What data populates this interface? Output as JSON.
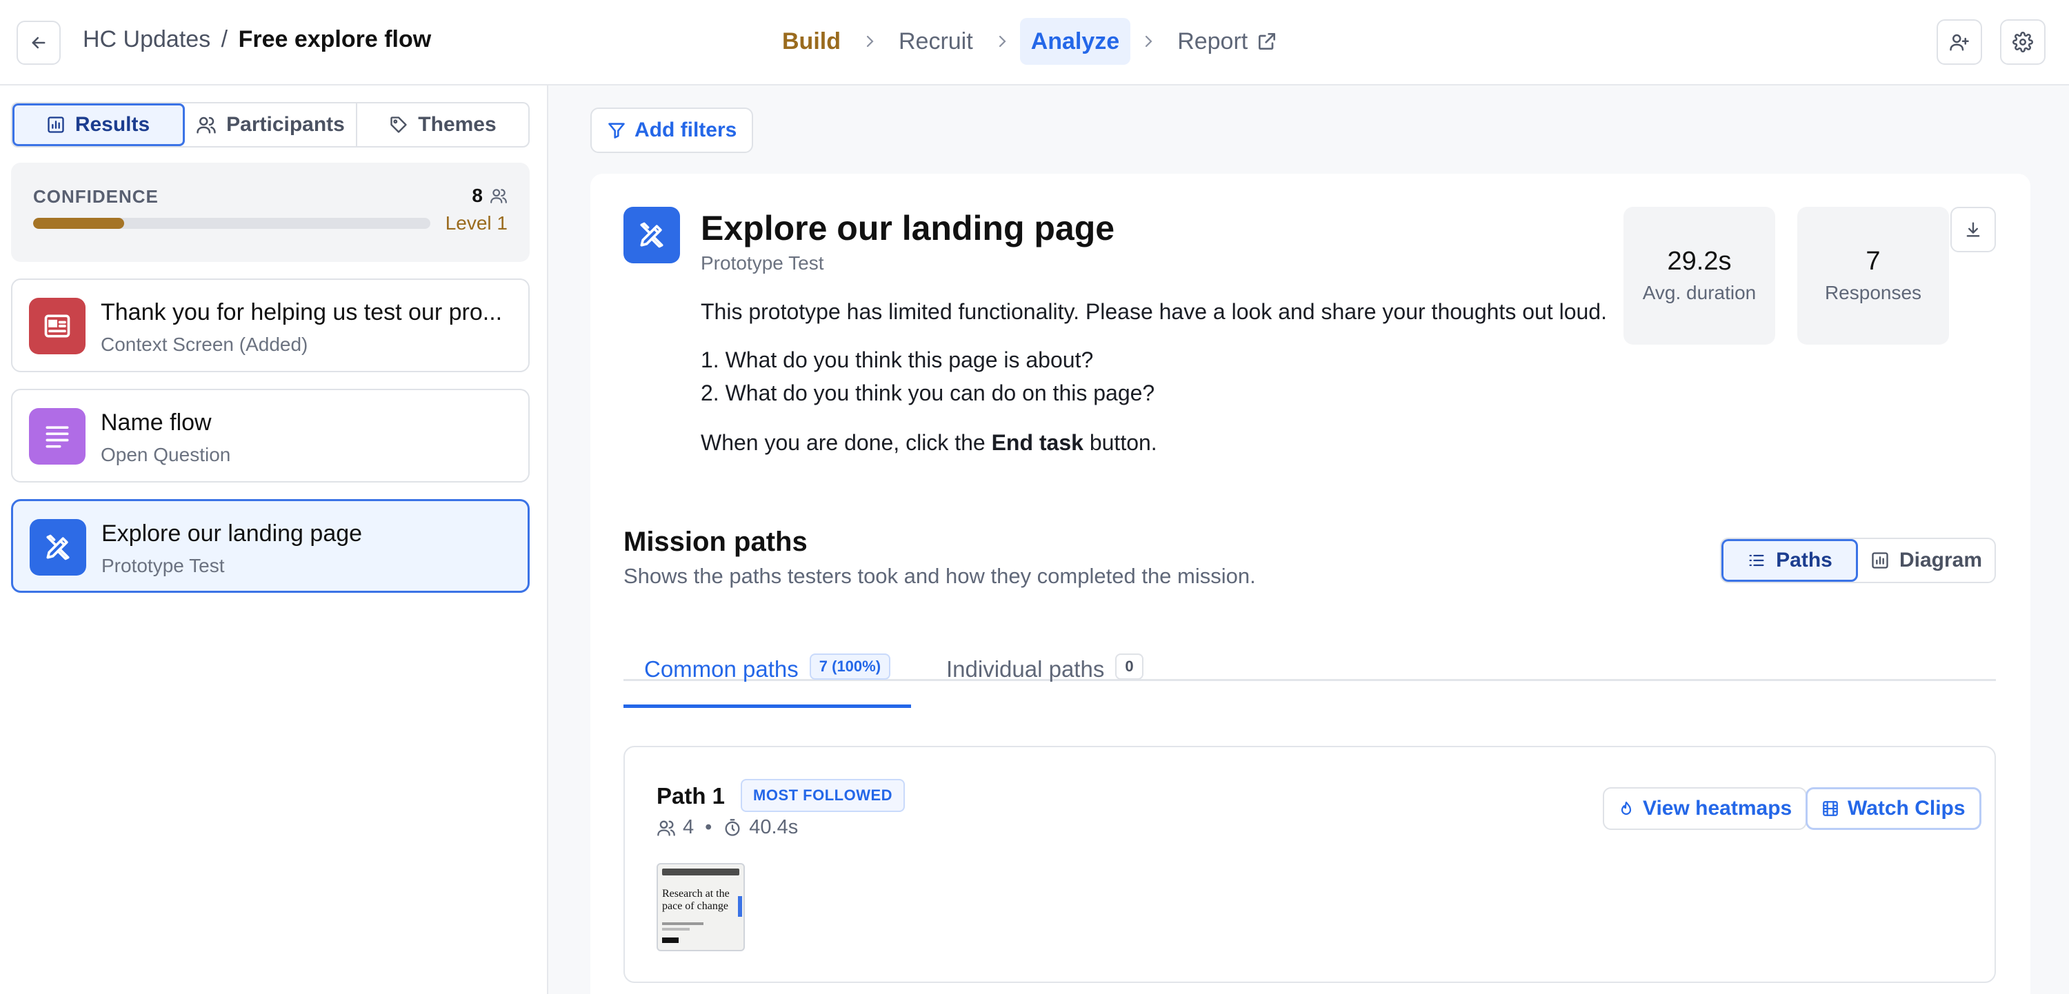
{
  "header": {
    "project": "HC Updates",
    "separator": "/",
    "study": "Free explore flow",
    "steps": [
      "Build",
      "Recruit",
      "Analyze",
      "Report"
    ]
  },
  "sidebar": {
    "tabs": [
      "Results",
      "Participants",
      "Themes"
    ],
    "confidence": {
      "title": "CONFIDENCE",
      "count": "8",
      "level": "Level 1",
      "progress": 0.23
    },
    "blocks": [
      {
        "title": "Thank you for helping us test our pro...",
        "subtitle": "Context Screen (Added)"
      },
      {
        "title": "Name flow",
        "subtitle": "Open Question"
      },
      {
        "title": "Explore our landing page",
        "subtitle": "Prototype Test"
      }
    ]
  },
  "main": {
    "filters_label": "Add filters",
    "task": {
      "title": "Explore our landing page",
      "type": "Prototype Test",
      "intro": "This prototype has limited functionality. Please have a look and share your thoughts out loud.",
      "questions": [
        "1. What do you think this page is about?",
        "2. What do you think you can do on this page?"
      ],
      "done_prefix": "When you are done, click the ",
      "done_bold": "End task",
      "done_suffix": " button."
    },
    "stats": [
      {
        "value": "29.2s",
        "label": "Avg. duration"
      },
      {
        "value": "7",
        "label": "Responses"
      }
    ],
    "mission": {
      "title": "Mission paths",
      "subtitle": "Shows the paths testers took and how they completed the mission.",
      "view_toggle": [
        "Paths",
        "Diagram"
      ],
      "tabs": [
        {
          "label": "Common paths",
          "count": "7 (100%)"
        },
        {
          "label": "Individual paths",
          "count": "0"
        }
      ]
    },
    "path": {
      "name": "Path 1",
      "badge": "MOST FOLLOWED",
      "testers": "4",
      "bullet": "•",
      "duration": "40.4s",
      "heatmaps_label": "View heatmaps",
      "clips_label": "Watch Clips",
      "thumbnail_text": "Research at the pace of change"
    }
  },
  "colors": {
    "accent": "#2467e8",
    "build": "#9a6b1e",
    "context_block": "#c9434a",
    "question_block": "#b06ce6",
    "prototype_block": "#2d6be6"
  }
}
